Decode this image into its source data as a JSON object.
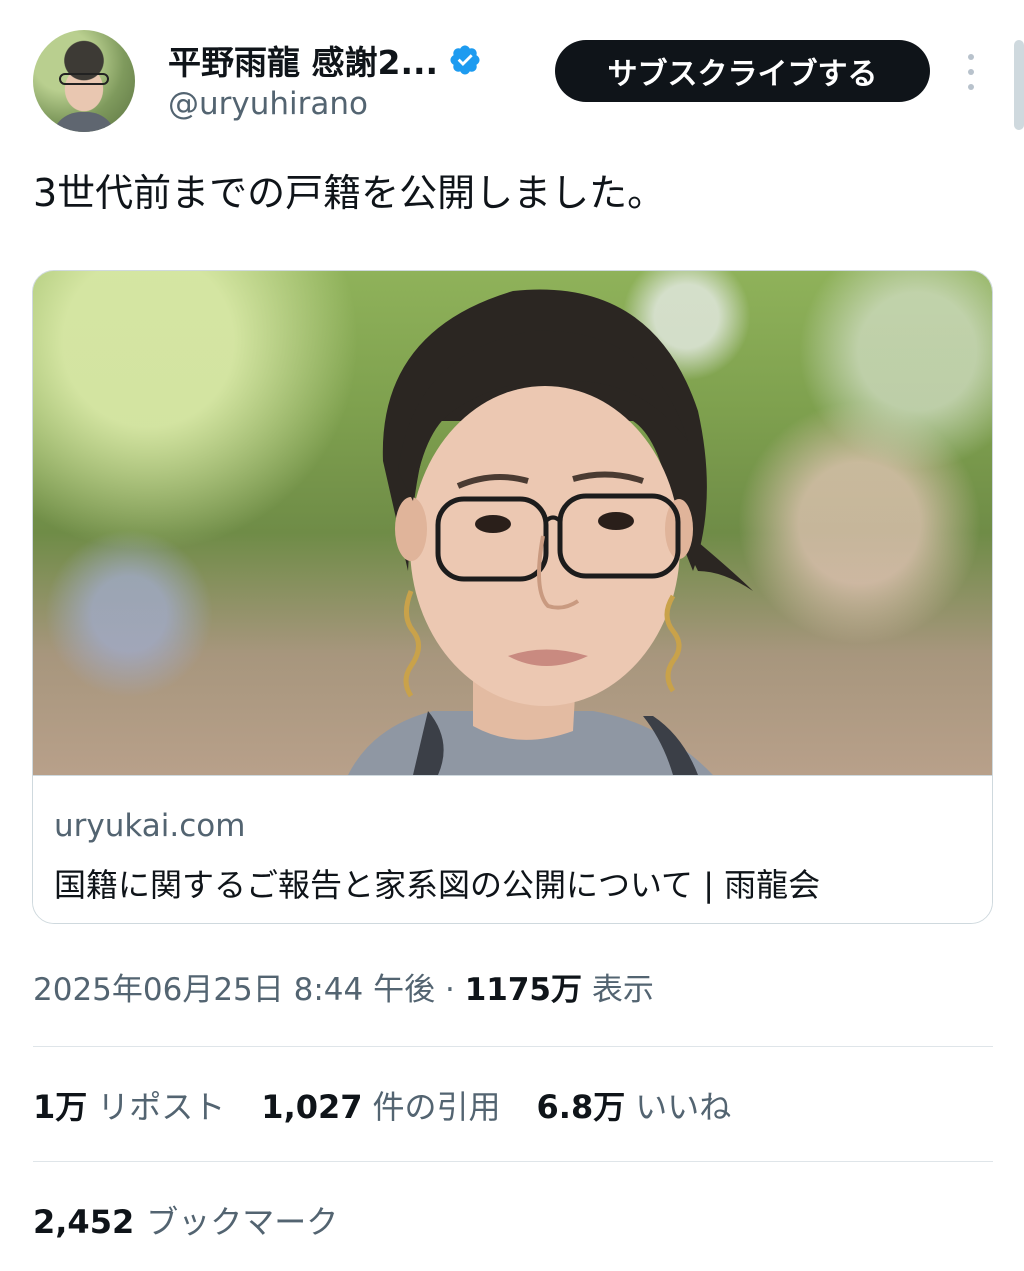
{
  "user": {
    "display_name": "平野雨龍 感謝2...",
    "handle": "@uryuhirano",
    "verified_color": "#1d9bf0",
    "avatar_icon": "profile-photo"
  },
  "subscribe_label": "サブスクライブする",
  "more_icon": "more-vertical-icon",
  "tweet": {
    "text": "3世代前までの戸籍を公開しました。"
  },
  "link_card": {
    "domain": "uryukai.com",
    "title": "国籍に関するご報告と家系図の公開について | 雨龍会"
  },
  "meta": {
    "date": "2025年06月25日 8:44 午後",
    "separator": "·",
    "views_count": "1175万",
    "views_label": "表示"
  },
  "stats": {
    "reposts_count": "1万",
    "reposts_label": "リポスト",
    "quotes_count": "1,027",
    "quotes_label": "件の引用",
    "likes_count": "6.8万",
    "likes_label": "いいね",
    "bookmarks_count": "2,452",
    "bookmarks_label": "ブックマーク"
  },
  "colors": {
    "text_primary": "#0f1419",
    "text_secondary": "#536471",
    "border": "#cfd9de",
    "button_bg": "#0f1419"
  }
}
